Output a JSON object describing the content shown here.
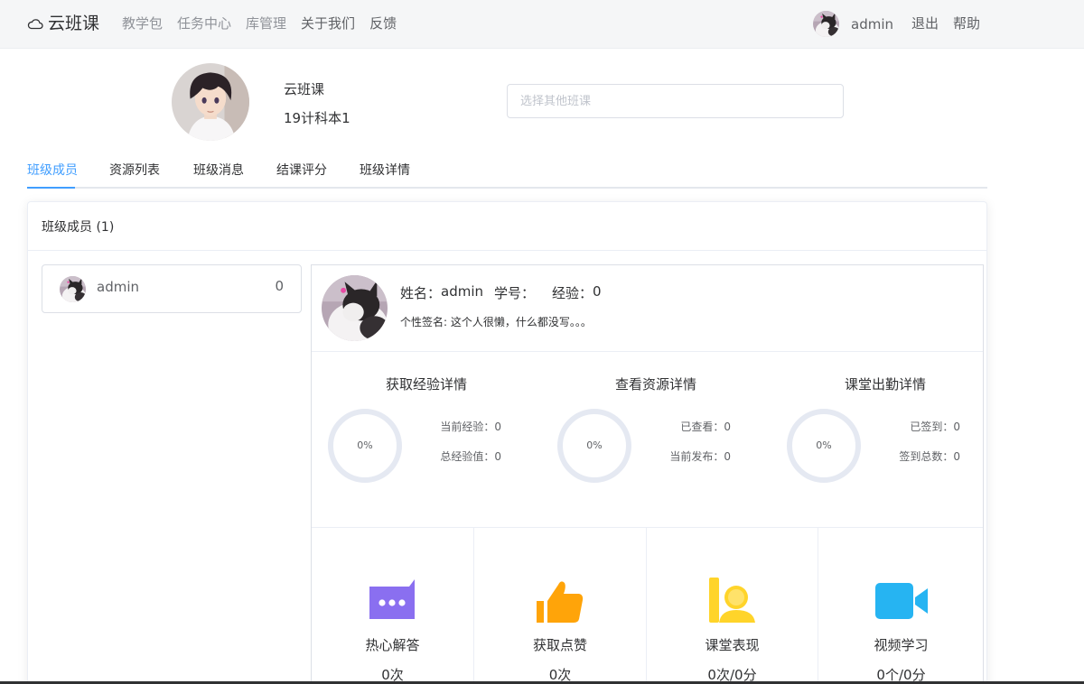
{
  "topbar": {
    "logo_text": "云班课",
    "nav": [
      "教学包",
      "任务中心",
      "库管理",
      "关于我们",
      "反馈"
    ],
    "user_name": "admin",
    "logout": "退出",
    "help": "帮助"
  },
  "class_info": {
    "name": "云班课",
    "code": "19计科本1",
    "select_placeholder": "选择其他班课"
  },
  "tabs": [
    "班级成员",
    "资源列表",
    "班级消息",
    "结课评分",
    "班级详情"
  ],
  "active_tab": "班级成员",
  "card": {
    "title": "班级成员 (1)"
  },
  "members": [
    {
      "name": "admin",
      "score": "0"
    }
  ],
  "detail": {
    "name_label": "姓名：",
    "name_value": "admin",
    "id_label": "学号：",
    "id_value": "",
    "exp_label": "经验：",
    "exp_value": "0",
    "signature": "个性签名: 这个人很懒，什么都没写。。。"
  },
  "stats": [
    {
      "title": "获取经验详情",
      "percent": "0%",
      "fraction": 0,
      "line1": "当前经验：0",
      "line2": "总经验值：0"
    },
    {
      "title": "查看资源详情",
      "percent": "0%",
      "fraction": 0,
      "line1": "已查看：0",
      "line2": "当前发布：0"
    },
    {
      "title": "课堂出勤详情",
      "percent": "0%",
      "fraction": 0,
      "line1": "已签到：0",
      "line2": "签到总数：0"
    }
  ],
  "metrics": [
    {
      "label": "热心解答",
      "value": "0次",
      "icon": "chat-bubble-icon",
      "color": "#8a6ff0"
    },
    {
      "label": "获取点赞",
      "value": "0次",
      "icon": "thumbs-up-icon",
      "color": "#ffa409"
    },
    {
      "label": "课堂表现",
      "value": "0次/0分",
      "icon": "performance-icon",
      "color": "#ffd42a"
    },
    {
      "label": "视频学习",
      "value": "0个/0分",
      "icon": "video-camera-icon",
      "color": "#26b4f2"
    }
  ],
  "colors": {
    "accent": "#409eff",
    "ring_track": "#e5e9f2"
  }
}
